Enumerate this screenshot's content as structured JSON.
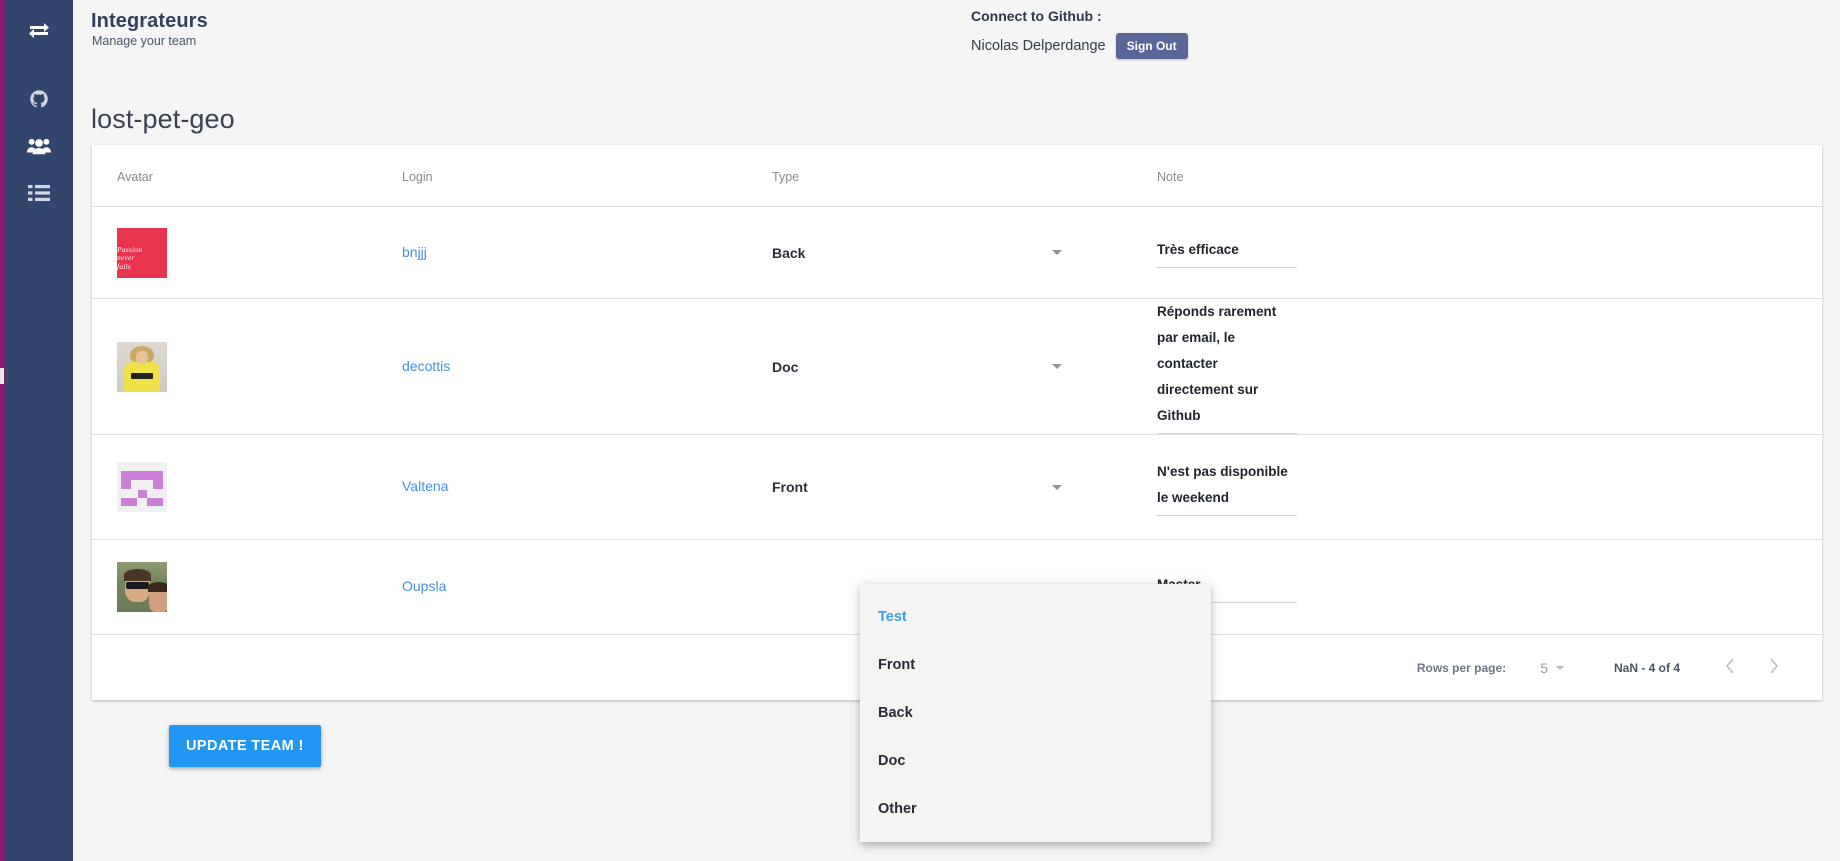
{
  "sidebar": {
    "items": [
      {
        "name": "exchange-arrows-icon",
        "label": "Switch"
      },
      {
        "name": "github-icon",
        "label": "Github"
      },
      {
        "name": "team-users-icon",
        "label": "Team"
      },
      {
        "name": "list-icon",
        "label": "List"
      }
    ]
  },
  "header": {
    "title": "Integrateurs",
    "subtitle": "Manage your team",
    "connect_label": "Connect to Github :",
    "user_name": "Nicolas Delperdange",
    "sign_out_label": "Sign Out"
  },
  "repo": {
    "name": "lost-pet-geo"
  },
  "table": {
    "columns": [
      "Avatar",
      "Login",
      "Type",
      "Note"
    ],
    "rows": [
      {
        "avatar": "passion-never-fails-poster",
        "avatar_lines": [
          "Passion",
          "never",
          "fails"
        ],
        "login": "bnjjj",
        "type": "Back",
        "note": "Très efficace"
      },
      {
        "avatar": "woman-yellow-shirt-photo",
        "login": "decottis",
        "type": "Doc",
        "note": "Réponds rarement par email, le contacter directement sur Github"
      },
      {
        "avatar": "purple-identicon",
        "login": "Valtena",
        "type": "Front",
        "note": "N'est pas disponible le weekend"
      },
      {
        "avatar": "man-sunglasses-photo",
        "login": "Oupsla",
        "type": "",
        "note": "Master"
      }
    ]
  },
  "pagination": {
    "rows_per_page_label": "Rows per page:",
    "rows_per_page_value": "5",
    "range_label": "NaN - 4 of 4",
    "prev_name": "previous-page",
    "next_name": "next-page"
  },
  "actions": {
    "update_team_label": "UPDATE TEAM !"
  },
  "dropdown": {
    "open": true,
    "selected": "Test",
    "options": [
      "Test",
      "Front",
      "Back",
      "Doc",
      "Other"
    ]
  },
  "colors": {
    "sidebar_bg": "#32456d",
    "edge_stripe": "#8d1b6e",
    "link_blue": "#4a90d9",
    "primary_blue": "#2196f3",
    "signout_bg": "#5a6697",
    "dropdown_selected": "#3d9cf0"
  }
}
